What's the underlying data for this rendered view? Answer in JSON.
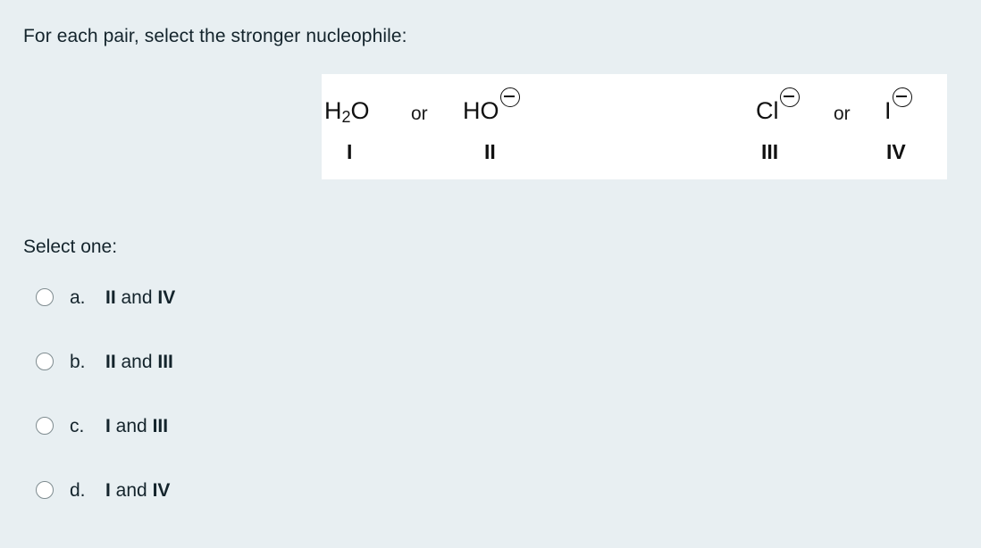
{
  "question": {
    "stem": "For each pair, select the stronger nucleophile:"
  },
  "figure": {
    "background": "#ffffff",
    "pairs": [
      {
        "left_species": "H",
        "left_species_sub": "2",
        "left_species_tail": "O",
        "conjunction": "or",
        "right_species": "HO",
        "right_charge": "minus-circle",
        "left_numeral": "I",
        "right_numeral": "II"
      },
      {
        "left_species": "Cl",
        "left_charge": "minus-circle",
        "conjunction": "or",
        "right_species": "I",
        "right_charge": "minus-circle",
        "left_numeral": "III",
        "right_numeral": "IV"
      }
    ]
  },
  "answers": {
    "prompt": "Select one:",
    "options": [
      {
        "letter": "a.",
        "first": "II",
        "middle": " and ",
        "second": "IV",
        "selected": false
      },
      {
        "letter": "b.",
        "first": "II",
        "middle": " and ",
        "second": "III",
        "selected": false
      },
      {
        "letter": "c.",
        "first": "I",
        "middle": " and ",
        "second": "III",
        "selected": false
      },
      {
        "letter": "d.",
        "first": "I",
        "middle": " and ",
        "second": "IV",
        "selected": false
      }
    ]
  },
  "colors": {
    "page_background": "#e8eff2",
    "text": "#14242c",
    "figure_ink": "#111111",
    "radio_border": "#7f8c90"
  }
}
